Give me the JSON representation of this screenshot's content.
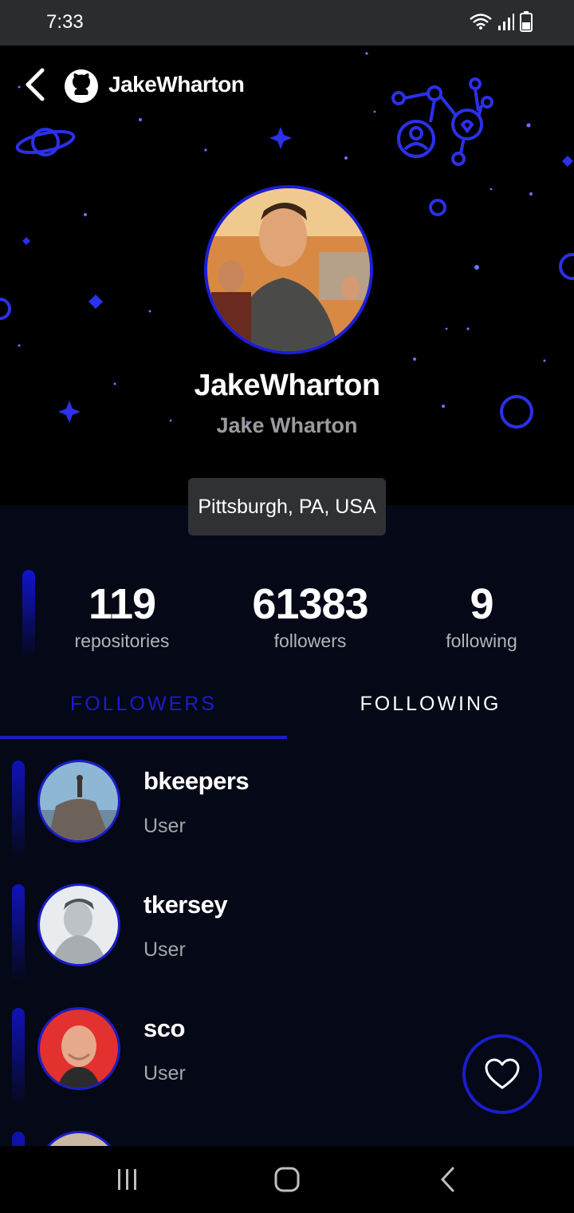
{
  "status_bar": {
    "time": "7:33"
  },
  "header": {
    "title": "JakeWharton"
  },
  "profile": {
    "username": "JakeWharton",
    "full_name": "Jake Wharton",
    "location": "Pittsburgh, PA, USA"
  },
  "stats": [
    {
      "value": "119",
      "label": "repositories"
    },
    {
      "value": "61383",
      "label": "followers"
    },
    {
      "value": "9",
      "label": "following"
    }
  ],
  "tabs": [
    {
      "label": "FOLLOWERS",
      "selected": true
    },
    {
      "label": "FOLLOWING",
      "selected": false
    }
  ],
  "list": [
    {
      "name": "bkeepers",
      "type": "User"
    },
    {
      "name": "tkersey",
      "type": "User"
    },
    {
      "name": "sco",
      "type": "User"
    }
  ],
  "colors": {
    "accent": "#1a1dc9",
    "background": "#050816",
    "hero": "#000000"
  },
  "icons": {
    "back": "back-arrow-icon",
    "github": "github-icon",
    "fab": "heart-icon"
  }
}
